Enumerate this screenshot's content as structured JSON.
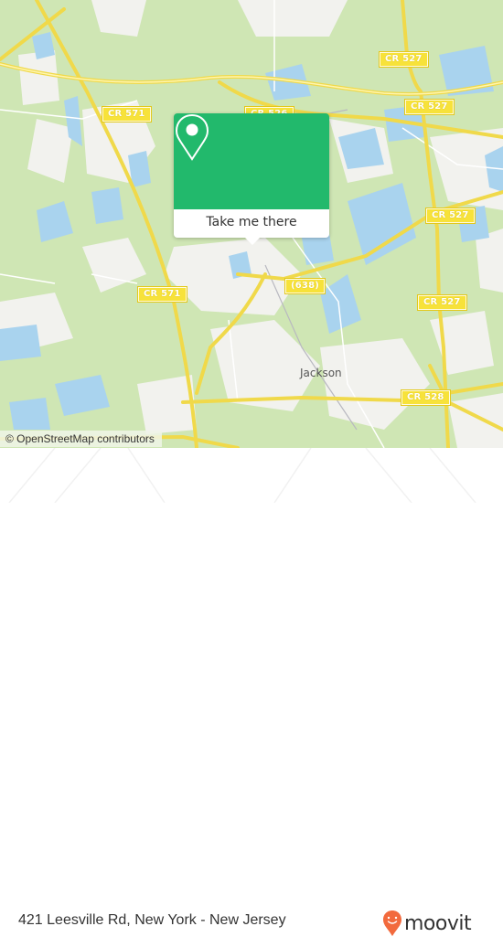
{
  "map": {
    "road_labels": [
      {
        "id": "cr527-top",
        "text": "CR 527"
      },
      {
        "id": "cr571-left",
        "text": "CR 571"
      },
      {
        "id": "cr526",
        "text": "CR 526"
      },
      {
        "id": "cr527-right-top",
        "text": "CR 527"
      },
      {
        "id": "cr527-mid",
        "text": "CR 527"
      },
      {
        "id": "cr571-mid",
        "text": "CR 571"
      },
      {
        "id": "r638",
        "text": "(638)"
      },
      {
        "id": "cr527-lower",
        "text": "CR 527"
      },
      {
        "id": "cr528",
        "text": "CR 528"
      }
    ],
    "town_label": "Jackson",
    "attribution": "© OpenStreetMap contributors"
  },
  "popup": {
    "button_label": "Take me there",
    "icon": "map-pin-icon"
  },
  "footer": {
    "address": "421 Leesville Rd, New York - New Jersey",
    "logo_text": "moovit",
    "logo_icon": "moovit-pin-logo-icon",
    "brand_color": "#f26a3d"
  },
  "colors": {
    "popup_green": "#22b96c",
    "map_green": "#cfe6b4",
    "water": "#a9d3ee",
    "road": "#f7e23a"
  }
}
